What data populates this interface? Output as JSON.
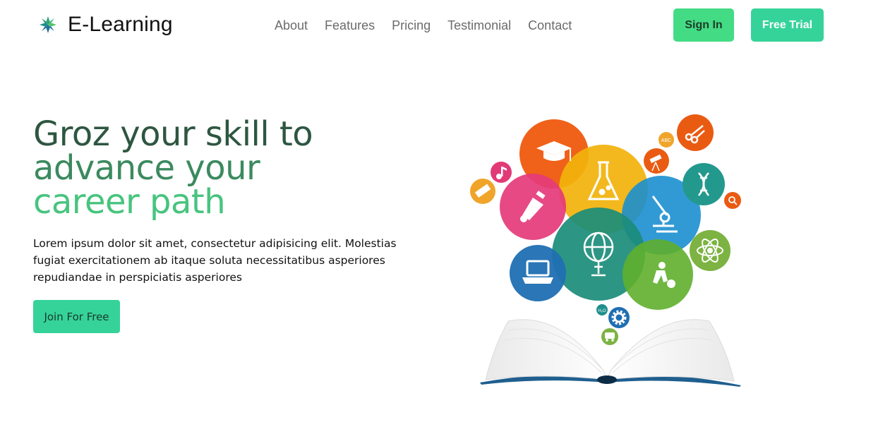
{
  "brand": {
    "name": "E-Learning",
    "icon": "star-logo-icon"
  },
  "nav": [
    {
      "label": "About"
    },
    {
      "label": "Features"
    },
    {
      "label": "Pricing"
    },
    {
      "label": "Testimonial"
    },
    {
      "label": "Contact"
    }
  ],
  "actions": {
    "signin_label": "Sign In",
    "trial_label": "Free Trial"
  },
  "hero": {
    "title_line1": "Groz your skill to",
    "title_line2": "advance your",
    "title_line3": "career path",
    "description": "Lorem ipsum dolor sit amet, consectetur adipisicing elit. Molestias fugiat exercitationem ab itaque soluta necessitatibus asperiores repudiandae in perspiciatis asperiores",
    "cta_label": "Join For Free"
  },
  "illustration": {
    "description_icon": "education-book-illustration",
    "small_labels": {
      "abc": "ABC",
      "h2o": "H₂O"
    }
  },
  "colors": {
    "title_dark": "#2e5641",
    "title_mid": "#3b8a5e",
    "title_light": "#47c47e",
    "signin_bg": "#43dc84",
    "trial_bg": "#35d39a",
    "nav_text": "#6b6b6b"
  }
}
